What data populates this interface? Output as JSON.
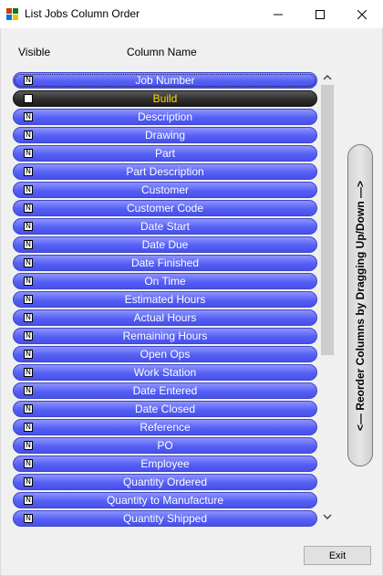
{
  "window": {
    "title": "List Jobs Column Order",
    "icons": {
      "app": "app-icon",
      "minimize": "minimize-icon",
      "maximize": "maximize-icon",
      "close": "close-icon"
    }
  },
  "headers": {
    "visible": "Visible",
    "column_name": "Column Name"
  },
  "rows": [
    {
      "label": "Job Number",
      "visible": true,
      "selected": false,
      "focused": true
    },
    {
      "label": "Build",
      "visible": false,
      "selected": true,
      "focused": false
    },
    {
      "label": "Description",
      "visible": true
    },
    {
      "label": "Drawing",
      "visible": true
    },
    {
      "label": "Part",
      "visible": true
    },
    {
      "label": "Part Description",
      "visible": true
    },
    {
      "label": "Customer",
      "visible": true
    },
    {
      "label": "Customer Code",
      "visible": true
    },
    {
      "label": "Date Start",
      "visible": true
    },
    {
      "label": "Date Due",
      "visible": true
    },
    {
      "label": "Date Finished",
      "visible": true
    },
    {
      "label": "On Time",
      "visible": true
    },
    {
      "label": "Estimated Hours",
      "visible": true
    },
    {
      "label": "Actual Hours",
      "visible": true
    },
    {
      "label": "Remaining Hours",
      "visible": true
    },
    {
      "label": "Open Ops",
      "visible": true
    },
    {
      "label": "Work Station",
      "visible": true
    },
    {
      "label": "Date Entered",
      "visible": true
    },
    {
      "label": "Date Closed",
      "visible": true
    },
    {
      "label": "Reference",
      "visible": true
    },
    {
      "label": "PO",
      "visible": true
    },
    {
      "label": "Employee",
      "visible": true
    },
    {
      "label": "Quantity Ordered",
      "visible": true
    },
    {
      "label": "Quantity to Manufacture",
      "visible": true
    },
    {
      "label": "Quantity Shipped",
      "visible": true
    }
  ],
  "checkbox_glyph": "N",
  "reorder_label": "<— Reorder Columns by Dragging Up/Down —>",
  "exit_label": "Exit",
  "colors": {
    "row_blue": "#5660f5",
    "row_dark": "#2b2b2b",
    "selected_text": "#ffd800"
  }
}
